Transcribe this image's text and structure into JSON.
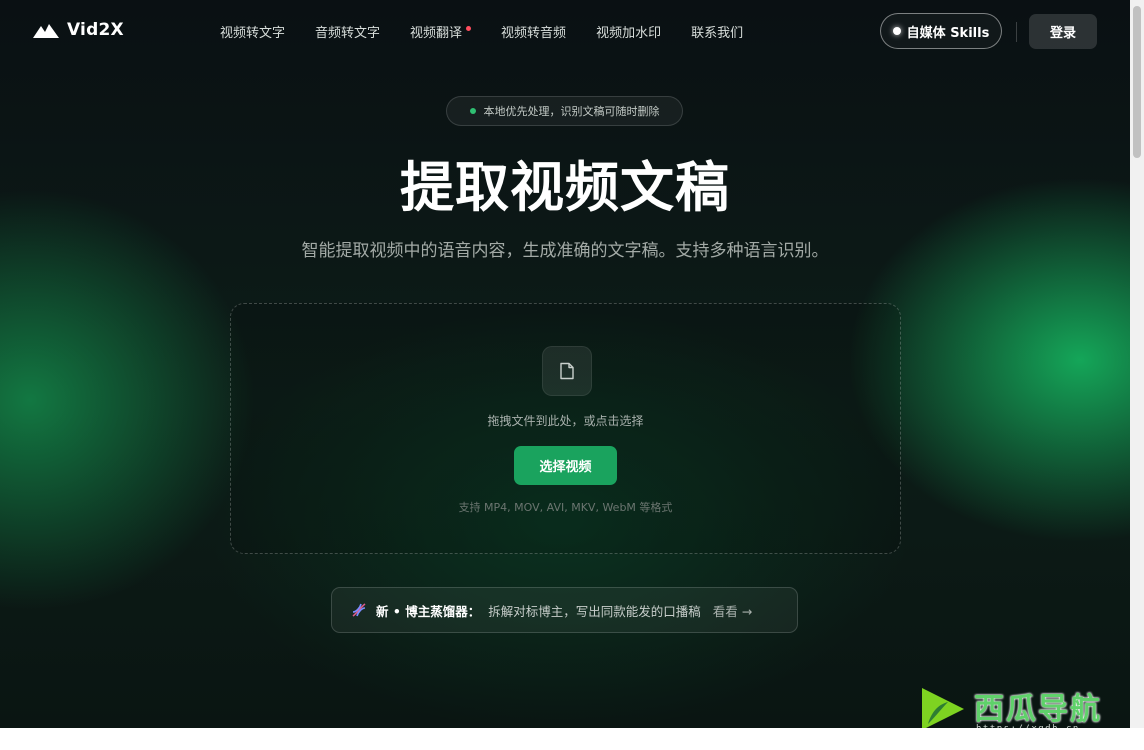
{
  "header": {
    "logo_text": "Vid2X",
    "nav": [
      {
        "label": "视频转文字",
        "badge": false
      },
      {
        "label": "音频转文字",
        "badge": false
      },
      {
        "label": "视频翻译",
        "badge": true
      },
      {
        "label": "视频转音频",
        "badge": false
      },
      {
        "label": "视频加水印",
        "badge": false
      },
      {
        "label": "联系我们",
        "badge": false
      }
    ],
    "skills_label": "自媒体 Skills",
    "login_label": "登录"
  },
  "hero": {
    "privacy_note": "本地优先处理，识别文稿可随时删除",
    "title": "提取视频文稿",
    "subtitle": "智能提取视频中的语音内容，生成准确的文字稿。支持多种语言识别。"
  },
  "upload": {
    "hint": "拖拽文件到此处，或点击选择",
    "button_label": "选择视频",
    "formats": "支持 MP4, MOV, AVI, MKV, WebM 等格式"
  },
  "promo": {
    "title": "新 • 博主蒸馏器：",
    "description": "拆解对标博主，写出同款能发的口播稿",
    "link_label": "看看 →"
  },
  "watermark": {
    "text": "西瓜导航",
    "url": "https://xgdh.cn"
  },
  "colors": {
    "accent": "#1aa35e",
    "background": "#0c1512",
    "badge_dot": "#ff4d5e"
  }
}
